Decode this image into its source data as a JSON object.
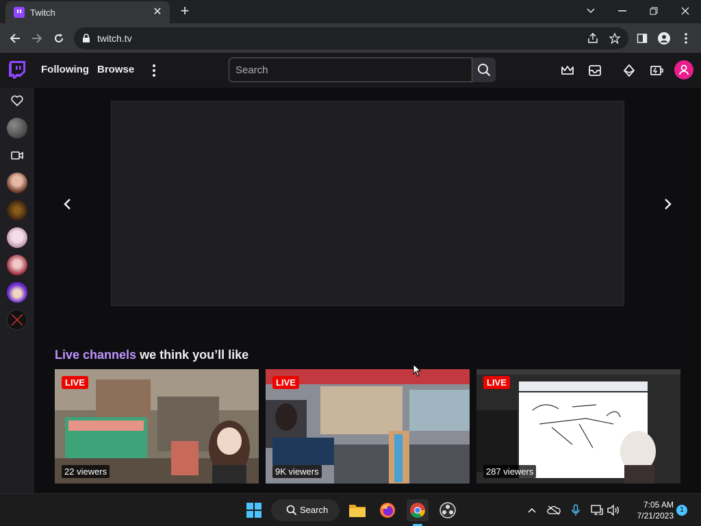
{
  "browser": {
    "tab_title": "Twitch",
    "url": "twitch.tv"
  },
  "nav": {
    "following": "Following",
    "browse": "Browse",
    "search_placeholder": "Search"
  },
  "section": {
    "title_accent": "Live channels",
    "title_rest": " we think you’ll like"
  },
  "cards": [
    {
      "badge": "LIVE",
      "viewers": "22 viewers"
    },
    {
      "badge": "LIVE",
      "viewers": "9K viewers"
    },
    {
      "badge": "LIVE",
      "viewers": "287 viewers"
    }
  ],
  "taskbar": {
    "search_label": "Search",
    "time": "7:05 AM",
    "date": "7/21/2023",
    "notification_count": "1"
  },
  "colors": {
    "brand": "#9146ff",
    "accent_text": "#bf94ff",
    "live_red": "#eb0400",
    "avatar_pink": "#e91e8c"
  }
}
